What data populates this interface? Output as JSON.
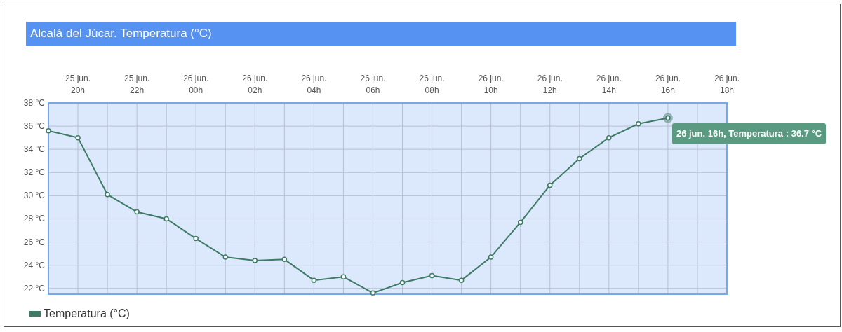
{
  "chart_data": {
    "type": "line",
    "title": "Alcalá del Júcar. Temperatura (°C)",
    "ylim": [
      21.5,
      38
    ],
    "categories": [
      null,
      "25 jun. 20h",
      null,
      "25 jun. 22h",
      null,
      "26 jun. 00h",
      null,
      "26 jun. 02h",
      null,
      "26 jun. 04h",
      null,
      "26 jun. 06h",
      null,
      "26 jun. 08h",
      null,
      "26 jun. 10h",
      null,
      "26 jun. 12h",
      null,
      "26 jun. 14h",
      null,
      "26 jun. 16h",
      null,
      "26 jun. 18h"
    ],
    "yticks": [
      {
        "value": 22,
        "label": "22 °C"
      },
      {
        "value": 24,
        "label": "24 °C"
      },
      {
        "value": 26,
        "label": "26 °C"
      },
      {
        "value": 28,
        "label": "28 °C"
      },
      {
        "value": 30,
        "label": "30 °C"
      },
      {
        "value": 32,
        "label": "32 °C"
      },
      {
        "value": 34,
        "label": "34 °C"
      },
      {
        "value": 36,
        "label": "36 °C"
      },
      {
        "value": 38,
        "label": "38 °C"
      }
    ],
    "series": [
      {
        "name": "Temperatura (°C)",
        "color": "#3e7b65",
        "marker": "circle",
        "values": [
          35.6,
          35.0,
          30.1,
          28.6,
          28.0,
          26.3,
          24.7,
          24.4,
          24.5,
          22.7,
          23.0,
          21.6,
          22.5,
          23.1,
          22.7,
          24.7,
          27.7,
          30.9,
          33.2,
          35.0,
          36.2,
          36.7,
          null,
          null
        ]
      }
    ],
    "grid": true,
    "annotations": [
      "26 jun. 16h, Temperatura : 36.7 °C"
    ]
  }
}
